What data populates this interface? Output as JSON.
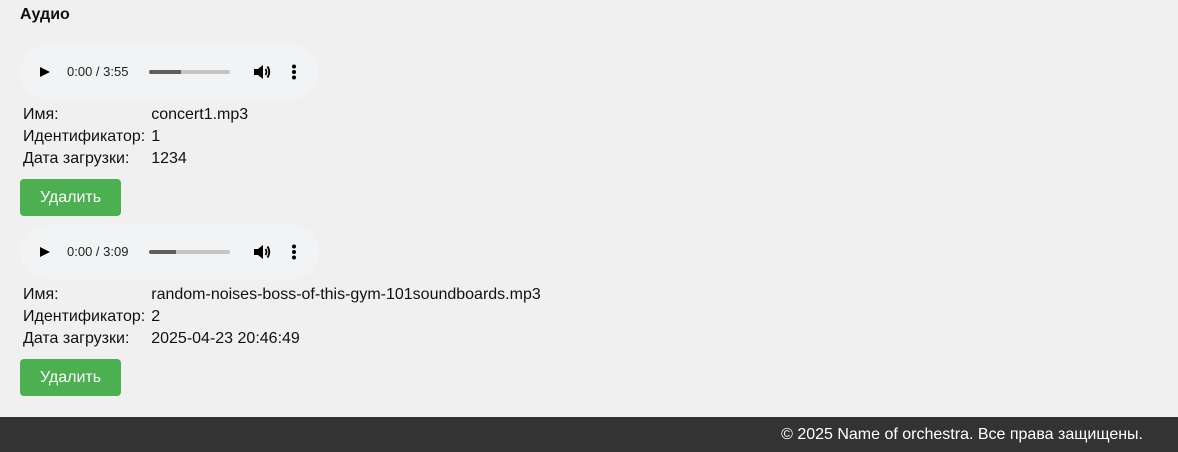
{
  "section": {
    "title": "Аудио"
  },
  "labels": {
    "name": "Имя:",
    "id": "Идентификатор:",
    "uploaded": "Дата загрузки:",
    "delete": "Удалить"
  },
  "items": [
    {
      "time": "0:00 / 3:55",
      "progress": 0.4,
      "name": "concert1.mp3",
      "id": "1",
      "uploaded": "1234"
    },
    {
      "time": "0:00 / 3:09",
      "progress": 0.33,
      "name": "random-noises-boss-of-this-gym-101soundboards.mp3",
      "id": "2",
      "uploaded": "2025-04-23 20:46:49"
    }
  ],
  "footer": {
    "text": "© 2025 Name of orchestra. Все права защищены."
  },
  "icons": {
    "play": "play-icon",
    "volume": "volume-icon",
    "more": "more-vert-icon"
  },
  "colors": {
    "background": "#f0f0f0",
    "player_bg": "#f1f3f4",
    "button": "#4caf50",
    "footer": "#333333"
  }
}
